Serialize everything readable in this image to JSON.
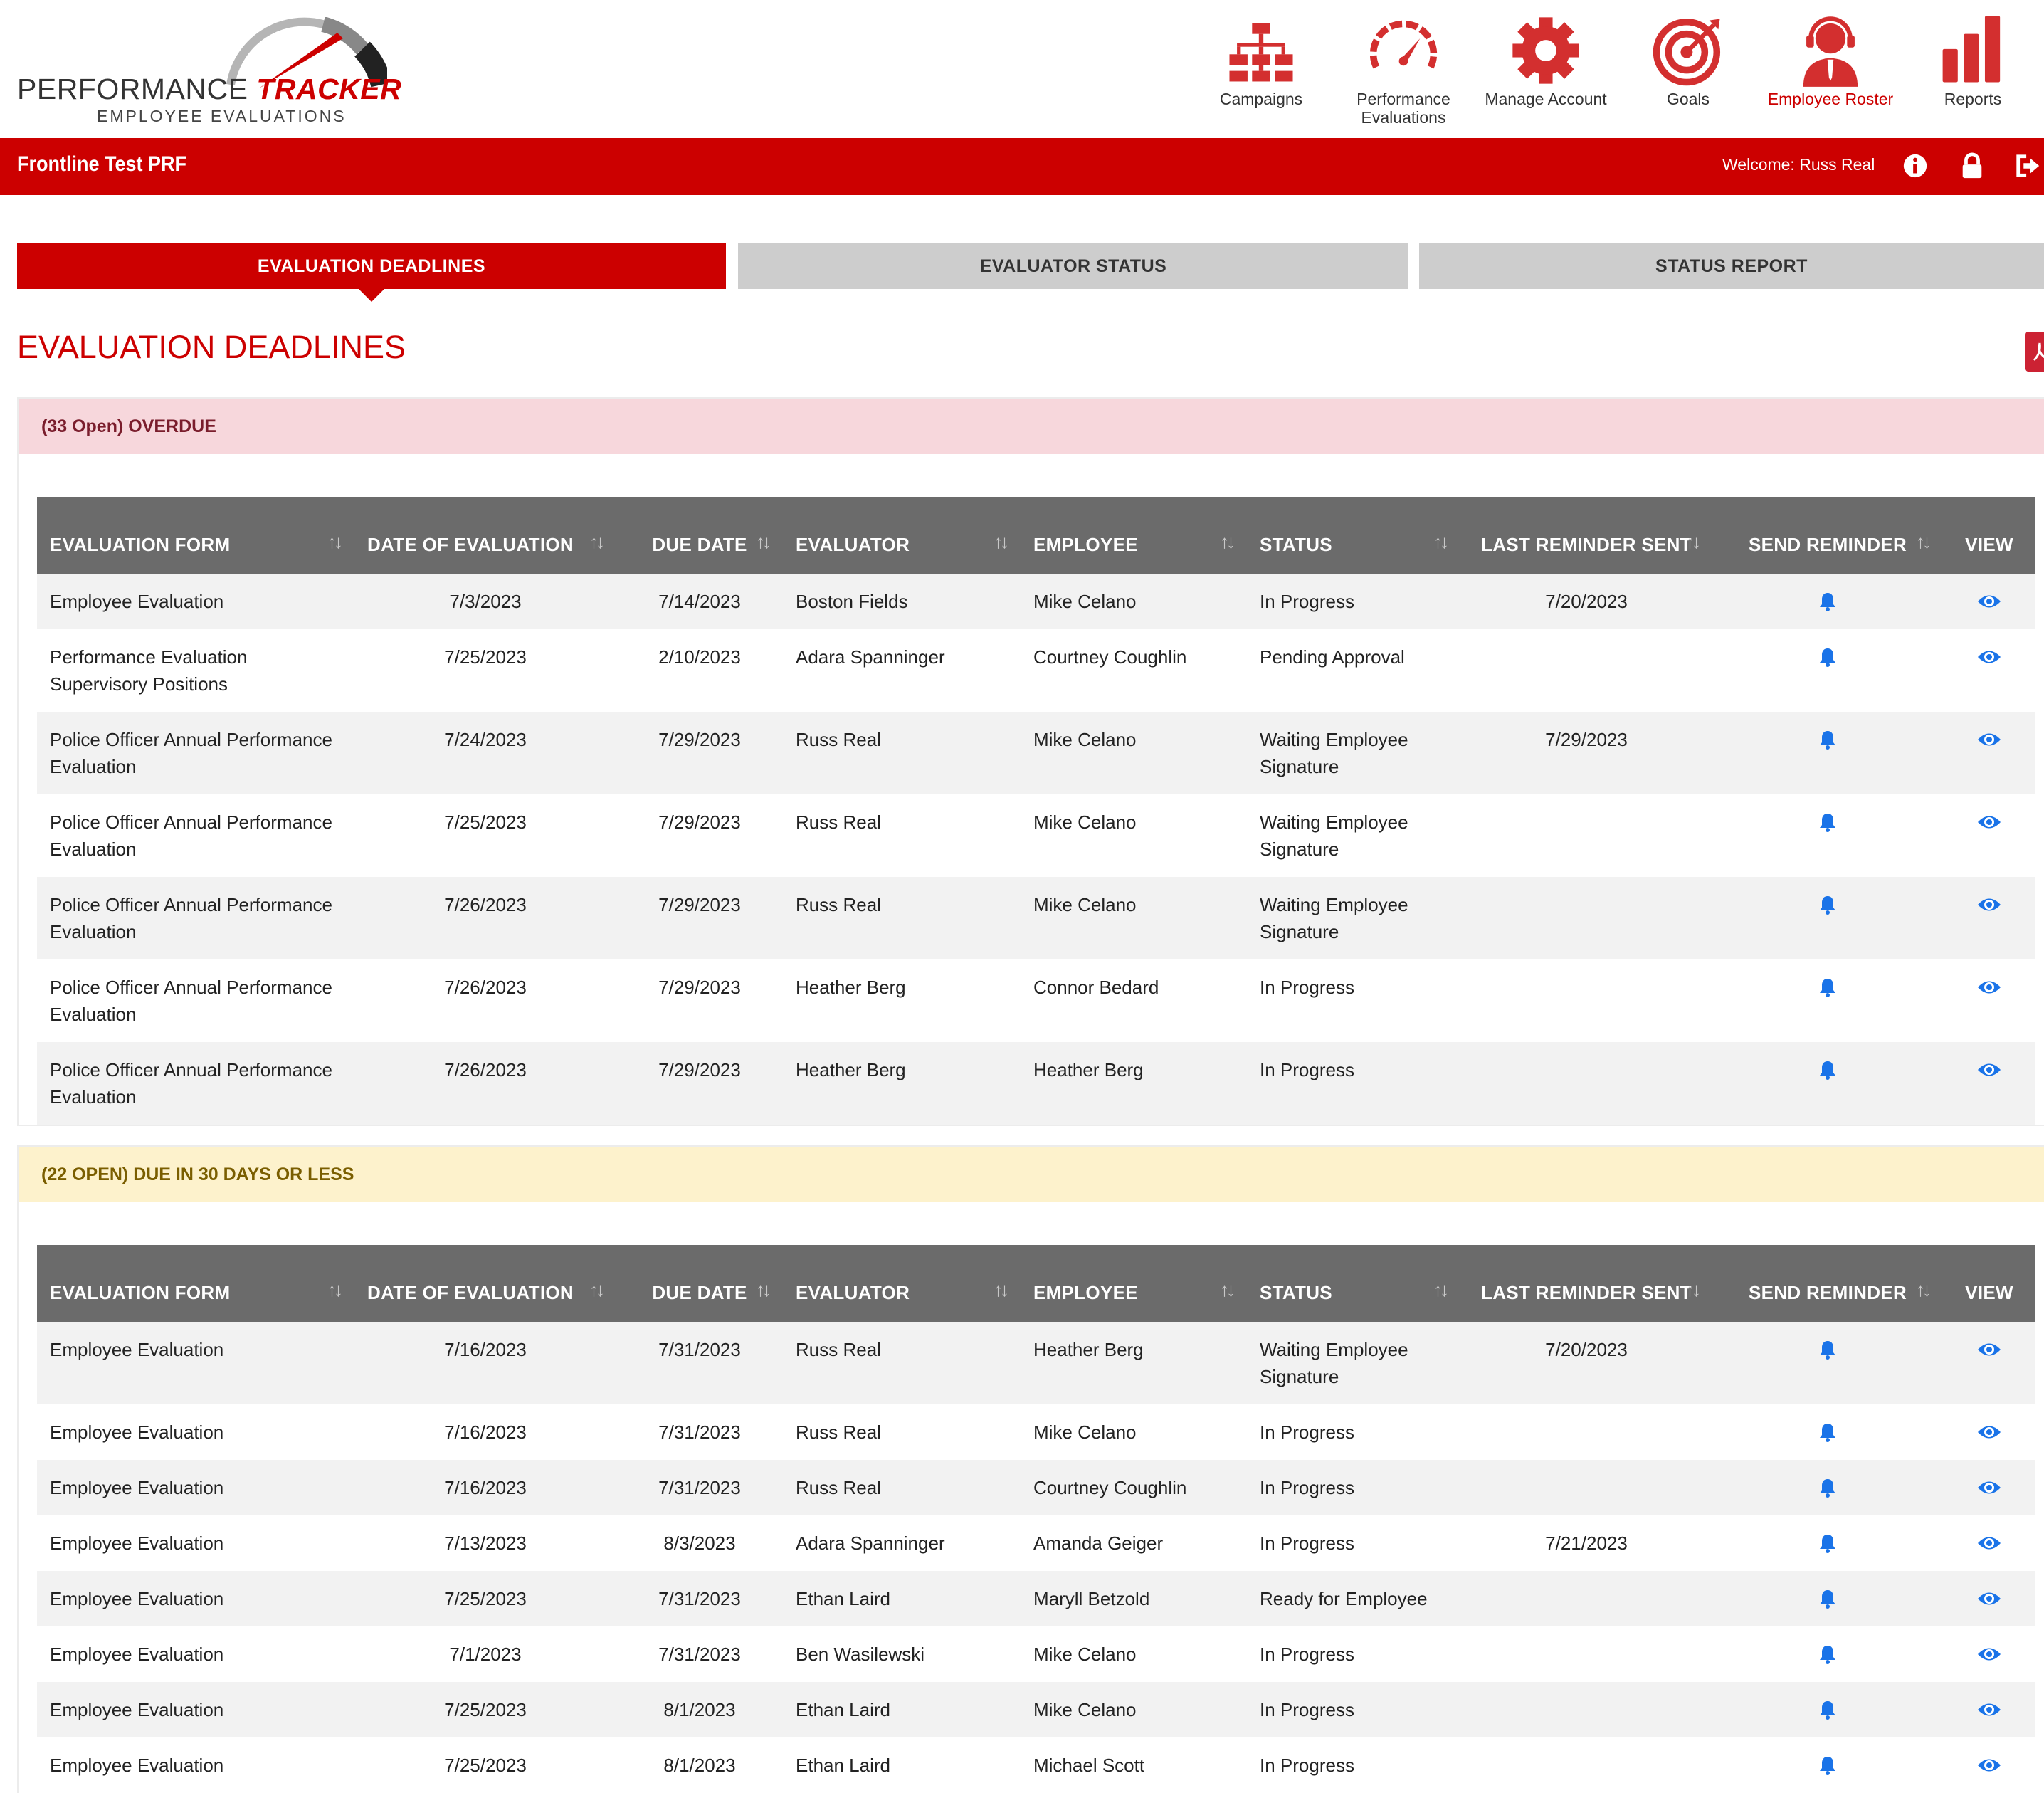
{
  "app": {
    "logo_word1": "PERFORMANCE",
    "logo_word2": "TRACKER",
    "logo_sub": "EMPLOYEE EVALUATIONS"
  },
  "nav": [
    {
      "label": "Campaigns",
      "icon": "hierarchy-icon",
      "active": false
    },
    {
      "label": "Performance Evaluations",
      "icon": "gauge-icon",
      "active": false
    },
    {
      "label": "Manage Account",
      "icon": "gear-icon",
      "active": false
    },
    {
      "label": "Goals",
      "icon": "target-icon",
      "active": false
    },
    {
      "label": "Employee Roster",
      "icon": "headset-user-icon",
      "active": true
    },
    {
      "label": "Reports",
      "icon": "bar-chart-icon",
      "active": false
    }
  ],
  "bar": {
    "title": "Frontline Test PRF",
    "welcome": "Welcome: Russ Real"
  },
  "tabs": [
    {
      "label": "EVALUATION DEADLINES",
      "active": true
    },
    {
      "label": "EVALUATOR STATUS",
      "active": false
    },
    {
      "label": "STATUS REPORT",
      "active": false
    }
  ],
  "page_title": "EVALUATION DEADLINES",
  "columns": [
    "EVALUATION FORM",
    "DATE OF EVALUATION",
    "DUE DATE",
    "EVALUATOR",
    "EMPLOYEE",
    "STATUS",
    "LAST REMINDER SENT",
    "SEND REMINDER",
    "VIEW"
  ],
  "colors": {
    "brand_red": "#cc0000",
    "icon_blue": "#1a73e8",
    "overdue_bg": "#f7d7dc",
    "due_bg": "#fdf2cc"
  },
  "sections": [
    {
      "heading": "(33 Open) OVERDUE",
      "rows": [
        {
          "form": "Employee Evaluation",
          "date": "7/3/2023",
          "due": "7/14/2023",
          "evaluator": "Boston Fields",
          "employee": "Mike Celano",
          "status": "In Progress",
          "last_reminder": "7/20/2023"
        },
        {
          "form": "Performance Evaluation Supervisory Positions",
          "date": "7/25/2023",
          "due": "2/10/2023",
          "evaluator": "Adara Spanninger",
          "employee": "Courtney Coughlin",
          "status": "Pending Approval",
          "last_reminder": ""
        },
        {
          "form": "Police Officer Annual Performance Evaluation",
          "date": "7/24/2023",
          "due": "7/29/2023",
          "evaluator": "Russ Real",
          "employee": "Mike Celano",
          "status": "Waiting Employee Signature",
          "last_reminder": "7/29/2023"
        },
        {
          "form": "Police Officer Annual Performance Evaluation",
          "date": "7/25/2023",
          "due": "7/29/2023",
          "evaluator": "Russ Real",
          "employee": "Mike Celano",
          "status": "Waiting Employee Signature",
          "last_reminder": ""
        },
        {
          "form": "Police Officer Annual Performance Evaluation",
          "date": "7/26/2023",
          "due": "7/29/2023",
          "evaluator": "Russ Real",
          "employee": "Mike Celano",
          "status": "Waiting Employee Signature",
          "last_reminder": ""
        },
        {
          "form": "Police Officer Annual Performance Evaluation",
          "date": "7/26/2023",
          "due": "7/29/2023",
          "evaluator": "Heather Berg",
          "employee": "Connor Bedard",
          "status": "In Progress",
          "last_reminder": ""
        },
        {
          "form": "Police Officer Annual Performance Evaluation",
          "date": "7/26/2023",
          "due": "7/29/2023",
          "evaluator": "Heather Berg",
          "employee": "Heather Berg",
          "status": "In Progress",
          "last_reminder": ""
        }
      ]
    },
    {
      "heading": "(22 OPEN) DUE IN 30 DAYS OR LESS",
      "rows": [
        {
          "form": "Employee Evaluation",
          "date": "7/16/2023",
          "due": "7/31/2023",
          "evaluator": "Russ Real",
          "employee": "Heather Berg",
          "status": "Waiting Employee Signature",
          "last_reminder": "7/20/2023"
        },
        {
          "form": "Employee Evaluation",
          "date": "7/16/2023",
          "due": "7/31/2023",
          "evaluator": "Russ Real",
          "employee": "Mike Celano",
          "status": "In Progress",
          "last_reminder": ""
        },
        {
          "form": "Employee Evaluation",
          "date": "7/16/2023",
          "due": "7/31/2023",
          "evaluator": "Russ Real",
          "employee": "Courtney Coughlin",
          "status": "In Progress",
          "last_reminder": ""
        },
        {
          "form": "Employee Evaluation",
          "date": "7/13/2023",
          "due": "8/3/2023",
          "evaluator": "Adara Spanninger",
          "employee": "Amanda Geiger",
          "status": "In Progress",
          "last_reminder": "7/21/2023"
        },
        {
          "form": "Employee Evaluation",
          "date": "7/25/2023",
          "due": "7/31/2023",
          "evaluator": "Ethan Laird",
          "employee": "Maryll Betzold",
          "status": "Ready for Employee",
          "last_reminder": ""
        },
        {
          "form": "Employee Evaluation",
          "date": "7/1/2023",
          "due": "7/31/2023",
          "evaluator": "Ben Wasilewski",
          "employee": "Mike Celano",
          "status": "In Progress",
          "last_reminder": ""
        },
        {
          "form": "Employee Evaluation",
          "date": "7/25/2023",
          "due": "8/1/2023",
          "evaluator": "Ethan Laird",
          "employee": "Mike Celano",
          "status": "In Progress",
          "last_reminder": ""
        },
        {
          "form": "Employee Evaluation",
          "date": "7/25/2023",
          "due": "8/1/2023",
          "evaluator": "Ethan Laird",
          "employee": "Michael Scott",
          "status": "In Progress",
          "last_reminder": ""
        }
      ]
    }
  ]
}
